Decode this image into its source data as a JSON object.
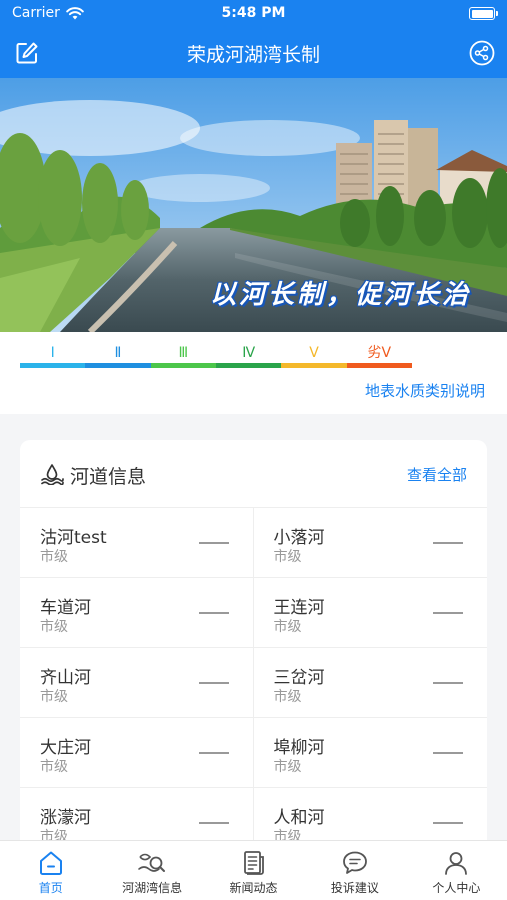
{
  "status": {
    "carrier": "Carrier",
    "time": "5:48 PM"
  },
  "nav": {
    "title": "荣成河湖湾长制"
  },
  "banner": {
    "slogan": "以河长制，促河长治"
  },
  "quality": {
    "grades": [
      {
        "label": "Ⅰ",
        "color": "#2bb3ea"
      },
      {
        "label": "Ⅱ",
        "color": "#1f8fe0"
      },
      {
        "label": "Ⅲ",
        "color": "#4cc64a"
      },
      {
        "label": "Ⅳ",
        "color": "#2aa44a"
      },
      {
        "label": "Ⅴ",
        "color": "#f4b82b"
      },
      {
        "label": "劣Ⅴ",
        "color": "#f05a1e"
      }
    ],
    "legend_link": "地表水质类别说明"
  },
  "rivers": {
    "title": "河道信息",
    "view_all": "查看全部",
    "items": [
      {
        "name": "沽河test",
        "level": "市级"
      },
      {
        "name": "小落河",
        "level": "市级"
      },
      {
        "name": "车道河",
        "level": "市级"
      },
      {
        "name": "王连河",
        "level": "市级"
      },
      {
        "name": "齐山河",
        "level": "市级"
      },
      {
        "name": "三岔河",
        "level": "市级"
      },
      {
        "name": "大庄河",
        "level": "市级"
      },
      {
        "name": "埠柳河",
        "level": "市级"
      },
      {
        "name": "涨濛河",
        "level": "市级"
      },
      {
        "name": "人和河",
        "level": "市级"
      }
    ]
  },
  "tabs": [
    {
      "label": "首页",
      "icon": "home-icon",
      "active": true
    },
    {
      "label": "河湖湾信息",
      "icon": "river-search-icon",
      "active": false
    },
    {
      "label": "新闻动态",
      "icon": "news-icon",
      "active": false
    },
    {
      "label": "投诉建议",
      "icon": "message-icon",
      "active": false
    },
    {
      "label": "个人中心",
      "icon": "user-icon",
      "active": false
    }
  ],
  "colors": {
    "primary": "#1a82f0",
    "text": "#333333",
    "muted": "#999999"
  }
}
